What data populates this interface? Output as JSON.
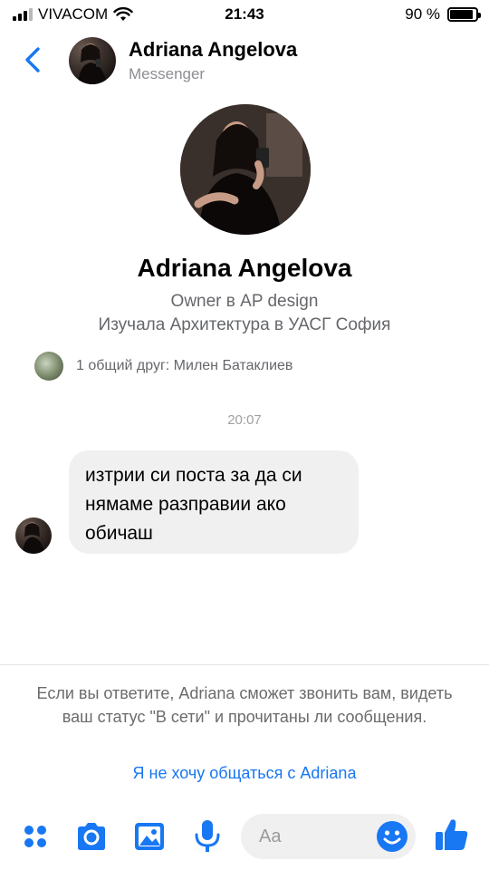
{
  "status_bar": {
    "carrier": "VIVACOM",
    "time": "21:43",
    "battery": "90 %",
    "battery_level": 0.9
  },
  "header": {
    "name": "Adriana Angelova",
    "subtitle": "Messenger"
  },
  "profile": {
    "name": "Adriana Angelova",
    "work": "Owner в AP design",
    "education": "Изучала Архитектура в УАСГ София",
    "mutual": "1 общий друг: Милен Батаклиев"
  },
  "conversation": {
    "timestamp": "20:07",
    "messages": [
      {
        "lines": [
          "изтрии си поста за да си",
          "нямаме разправии  ако",
          "обичаш"
        ]
      }
    ]
  },
  "notice": {
    "text": "Если вы ответите, Adriana сможет звонить вам, видеть ваш статус \"В сети\" и прочитаны ли сообщения.",
    "ignore_link": "Я не хочу общаться с Adriana"
  },
  "composer": {
    "placeholder": "Aa",
    "icons": [
      "menu-dots-icon",
      "camera-icon",
      "gallery-icon",
      "microphone-icon",
      "emoji-icon",
      "thumbs-up-icon"
    ]
  },
  "colors": {
    "accent": "#1877f2",
    "bubble": "#f0f0f0",
    "secondary_text": "#65676b"
  }
}
